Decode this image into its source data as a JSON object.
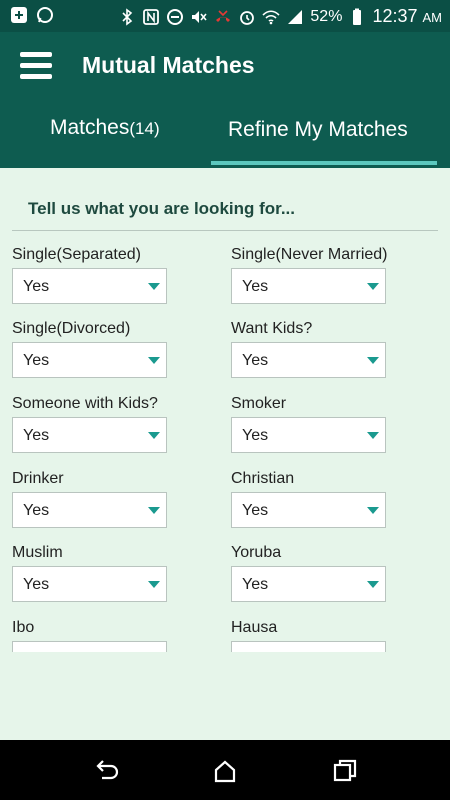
{
  "status_bar": {
    "battery": "52%",
    "time": "12:37",
    "ampm": "AM",
    "icons": [
      "notification-plus-icon",
      "whatsapp-icon",
      "bluetooth-icon",
      "nfc-icon",
      "block-icon",
      "mute-icon",
      "missed-call-icon",
      "alarm-icon",
      "wifi-icon",
      "signal-icon",
      "battery-icon"
    ]
  },
  "app_bar": {
    "title": "Mutual Matches"
  },
  "tabs": [
    {
      "label": "Matches",
      "count": "(14)"
    },
    {
      "label": "Refine My Matches"
    }
  ],
  "form": {
    "heading": "Tell us what you are looking for...",
    "fields": [
      {
        "label": "Single(Separated)",
        "value": "Yes"
      },
      {
        "label": "Single(Never Married)",
        "value": "Yes"
      },
      {
        "label": "Single(Divorced)",
        "value": "Yes"
      },
      {
        "label": "Want Kids?",
        "value": "Yes"
      },
      {
        "label": "Someone with Kids?",
        "value": "Yes"
      },
      {
        "label": "Smoker",
        "value": "Yes"
      },
      {
        "label": "Drinker",
        "value": "Yes"
      },
      {
        "label": "Christian",
        "value": "Yes"
      },
      {
        "label": "Muslim",
        "value": "Yes"
      },
      {
        "label": "Yoruba",
        "value": "Yes"
      },
      {
        "label": "Ibo",
        "value": ""
      },
      {
        "label": "Hausa",
        "value": ""
      }
    ]
  },
  "colors": {
    "header": "#0e5c50",
    "status_bar": "#0b4f45",
    "tab_indicator": "#5cc8be",
    "background": "#e6f5ea",
    "caret": "#1a9a8f"
  }
}
